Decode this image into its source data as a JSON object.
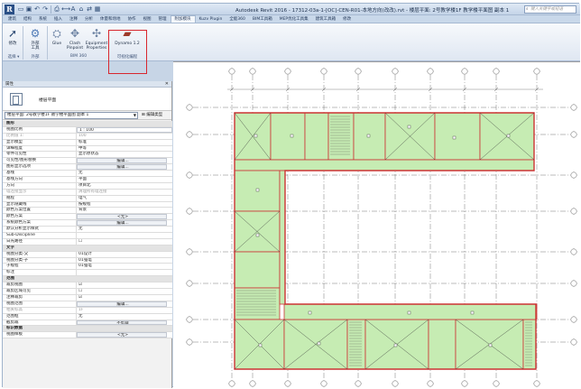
{
  "titlebar": {
    "logo": "R",
    "title": "Autodesk Revit 2016 -  17312-03a-1-[OC]-CEN-R01-本地方向(改改).rvt - 楼层平面: 2号教学楼1F 教学楼平面图 副本 1",
    "search_placeholder": "键入关键字或短语"
  },
  "quick_access": [
    "open-icon",
    "save-icon",
    "undo-icon",
    "redo-icon",
    "print-icon",
    "measure-icon",
    "text-icon",
    "3d-icon",
    "sync-icon",
    "views-icon"
  ],
  "tabs": [
    {
      "label": "建筑",
      "active": false
    },
    {
      "label": "结构",
      "active": false
    },
    {
      "label": "系统",
      "active": false
    },
    {
      "label": "插入",
      "active": false
    },
    {
      "label": "注释",
      "active": false
    },
    {
      "label": "分析",
      "active": false
    },
    {
      "label": "体量和场地",
      "active": false
    },
    {
      "label": "协作",
      "active": false
    },
    {
      "label": "视图",
      "active": false
    },
    {
      "label": "管理",
      "active": false
    },
    {
      "label": "附加模块",
      "active": true
    },
    {
      "label": "Kuzv Plugin",
      "active": false
    },
    {
      "label": "全能360",
      "active": false
    },
    {
      "label": "BIM工具箱",
      "active": false
    },
    {
      "label": "MEP优化工具集",
      "active": false
    },
    {
      "label": "建筑工具箱",
      "active": false
    },
    {
      "label": "修改",
      "active": false
    }
  ],
  "ribbon": {
    "buttons": [
      {
        "label": "修改",
        "icon": "cursor-icon"
      },
      {
        "label": "外部\n工具",
        "icon": "gears-icon"
      },
      {
        "label": "Glue",
        "icon": "glue-icon"
      },
      {
        "label": "Clash\nPinpoint",
        "icon": "clash-icon"
      },
      {
        "label": "Equipment\nProperties",
        "icon": "equipment-icon"
      },
      {
        "label": "Dynamo 1.2",
        "icon": "dynamo-icon"
      }
    ],
    "groups": [
      "选择 ▾",
      "外部",
      "BIM 360",
      "可视化编程"
    ]
  },
  "properties": {
    "header": "属性",
    "type_name": "楼层平面",
    "instance_label": "楼层平面: 2号教学楼1F 教学楼平面图 副本 1",
    "edit_type": "编辑类型",
    "rows": [
      {
        "k": "图形",
        "v": "",
        "kind": "group"
      },
      {
        "k": "视图比例",
        "v": "1 : 100",
        "kind": "input"
      },
      {
        "k": "比例值 1:",
        "v": "100",
        "kind": "dim"
      },
      {
        "k": "显示模型",
        "v": "标准",
        "kind": "text"
      },
      {
        "k": "详细程度",
        "v": "中等",
        "kind": "text"
      },
      {
        "k": "零件可见性",
        "v": "显示原状态",
        "kind": "text"
      },
      {
        "k": "可见性/图形替换",
        "v": "编辑...",
        "kind": "btn"
      },
      {
        "k": "图形显示选项",
        "v": "编辑...",
        "kind": "btn"
      },
      {
        "k": "基线",
        "v": "无",
        "kind": "text"
      },
      {
        "k": "基线方向",
        "v": "平面",
        "kind": "text"
      },
      {
        "k": "方向",
        "v": "项目北",
        "kind": "text"
      },
      {
        "k": "墙连接显示",
        "v": "清理所有墙连接",
        "kind": "dim"
      },
      {
        "k": "规程",
        "v": "电气",
        "kind": "text"
      },
      {
        "k": "显示隐藏线",
        "v": "按规程",
        "kind": "text"
      },
      {
        "k": "颜色方案位置",
        "v": "背景",
        "kind": "text"
      },
      {
        "k": "颜色方案",
        "v": "<无>",
        "kind": "btn"
      },
      {
        "k": "系统颜色方案",
        "v": "编辑...",
        "kind": "btn"
      },
      {
        "k": "默认分析显示样式",
        "v": "无",
        "kind": "text"
      },
      {
        "k": "Sub-Discipline",
        "v": "",
        "kind": "text"
      },
      {
        "k": "日光路径",
        "v": "☐",
        "kind": "check"
      },
      {
        "k": "文字",
        "v": "",
        "kind": "group"
      },
      {
        "k": "视图分类-父",
        "v": "01设计",
        "kind": "text"
      },
      {
        "k": "视图分类-子",
        "v": "01强电",
        "kind": "text"
      },
      {
        "k": "子规程",
        "v": "01强电",
        "kind": "text"
      },
      {
        "k": "标注",
        "v": "",
        "kind": "text"
      },
      {
        "k": "范围",
        "v": "",
        "kind": "group"
      },
      {
        "k": "裁剪视图",
        "v": "☑",
        "kind": "check"
      },
      {
        "k": "裁剪区域可见",
        "v": "☐",
        "kind": "check"
      },
      {
        "k": "注释裁剪",
        "v": "☑",
        "kind": "check"
      },
      {
        "k": "视图范围",
        "v": "编辑...",
        "kind": "btn"
      },
      {
        "k": "相关标高",
        "v": "1F",
        "kind": "dim"
      },
      {
        "k": "范围框",
        "v": "无",
        "kind": "text"
      },
      {
        "k": "截剪裁",
        "v": "不剪裁",
        "kind": "btn"
      },
      {
        "k": "标识数据",
        "v": "",
        "kind": "group"
      },
      {
        "k": "视图样板",
        "v": "<无>",
        "kind": "btn"
      }
    ]
  },
  "colors": {
    "room_fill": "#c6ecb3",
    "wall": "#cc3333",
    "grid": "#555555",
    "accent_red": "#d8262e"
  }
}
